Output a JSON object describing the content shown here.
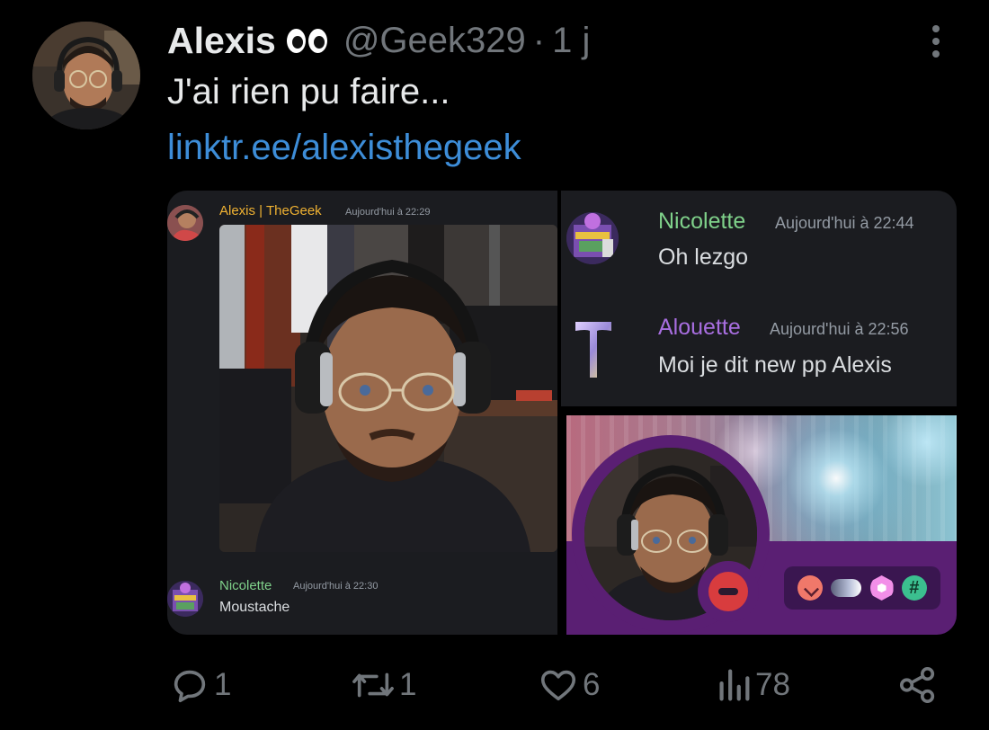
{
  "tweet": {
    "author": {
      "display_name": "Alexis",
      "emoji": "eyes",
      "handle": "@Geek329",
      "separator": "·",
      "time": "1 j"
    },
    "text": "J'ai rien pu faire...",
    "link": "linktr.ee/alexisthegeek",
    "actions": {
      "replies": "1",
      "retweets": "1",
      "likes": "6",
      "views": "78"
    }
  },
  "screenshot_left": {
    "message1": {
      "author": "Alexis | TheGeek",
      "timestamp": "Aujourd'hui à 22:29"
    },
    "message2": {
      "author": "Nicolette",
      "timestamp": "Aujourd'hui à 22:30",
      "text": "Moustache"
    }
  },
  "screenshot_right_top": {
    "message1": {
      "author": "Nicolette",
      "timestamp": "Aujourd'hui à 22:44",
      "text": "Oh lezgo"
    },
    "message2": {
      "author": "Alouette",
      "timestamp": "Aujourd'hui à 22:56",
      "text": "Moi je dit new pp Alexis"
    }
  },
  "screenshot_right_bottom": {
    "status": "do-not-disturb",
    "badges": [
      "hypesquad-icon",
      "nitro-icon",
      "boost-icon",
      "hashtag-icon"
    ],
    "badge_hashtag": "#"
  },
  "colors": {
    "background": "#000000",
    "link": "#3d8dd8",
    "muted": "#71767b",
    "discord_panel": "#1b1c20",
    "alexis_name": "#f0b232",
    "nicolette_name": "#7fd18a",
    "alouette_name": "#a86ee0",
    "profile_theme": "#5a1f73"
  }
}
